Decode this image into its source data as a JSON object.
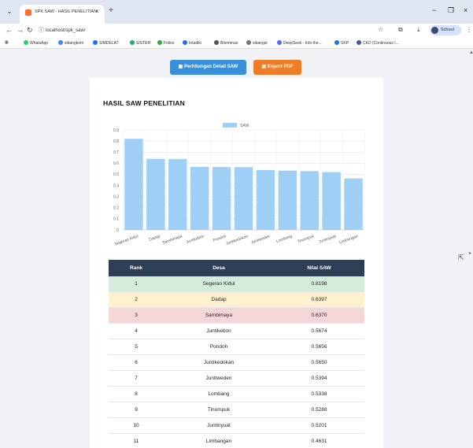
{
  "browser": {
    "tab_title": "SPK SAW - HASIL PENELITIAN",
    "url": "localhost/spk_saw/",
    "profile_name": "School",
    "bookmarks": [
      "WhatsApp",
      "sibangkom",
      "SIMDELAT",
      "SISTER",
      "Folios",
      "Intadiki",
      "Bitemmas",
      "sibangst",
      "DeepSeek - Into the...",
      "SKP",
      "CKD (Continuous I..."
    ]
  },
  "toolbar": {
    "detail_label": "Perhitungan Detail SAW",
    "pdf_label": "Export PDF",
    "detail_icon": "calculator-icon",
    "pdf_icon": "file-pdf-icon"
  },
  "page": {
    "title": "HASIL SAW PENELITIAN"
  },
  "chart_data": {
    "type": "bar",
    "title": "",
    "legend": [
      "SAW"
    ],
    "legend_position": "top",
    "categories": [
      "Segeran Kidul",
      "Dadap",
      "Sambimaya",
      "Juntikebon",
      "Pondoh",
      "Juntikedokan",
      "Juntiweden",
      "Lombang",
      "Tinumpuk",
      "Juntinyuat",
      "Limbangan"
    ],
    "series": [
      {
        "name": "SAW",
        "values": [
          0.8198,
          0.6397,
          0.637,
          0.5674,
          0.5656,
          0.565,
          0.5394,
          0.5338,
          0.5288,
          0.5201,
          0.4631
        ]
      }
    ],
    "ylim": [
      0,
      0.9
    ],
    "yticks": [
      "0",
      "0.1",
      "0.2",
      "0.3",
      "0.4",
      "0.5",
      "0.6",
      "0.7",
      "0.8",
      "0.9"
    ],
    "grid": true,
    "color": "#9fcff5"
  },
  "table": {
    "headers": [
      "Rank",
      "Desa",
      "Nilai SAW"
    ],
    "rows": [
      [
        "1",
        "Segeran Kidul",
        "0.8198"
      ],
      [
        "2",
        "Dadap",
        "0.6397"
      ],
      [
        "3",
        "Sambimaya",
        "0.6370"
      ],
      [
        "4",
        "Juntikebon",
        "0.5674"
      ],
      [
        "5",
        "Pondoh",
        "0.5656"
      ],
      [
        "6",
        "Juntikedokan",
        "0.5650"
      ],
      [
        "7",
        "Juntiweden",
        "0.5394"
      ],
      [
        "8",
        "Lombang",
        "0.5338"
      ],
      [
        "9",
        "Tinumpuk",
        "0.5288"
      ],
      [
        "10",
        "Juntinyuat",
        "0.5201"
      ],
      [
        "11",
        "Limbangan",
        "0.4631"
      ]
    ]
  }
}
